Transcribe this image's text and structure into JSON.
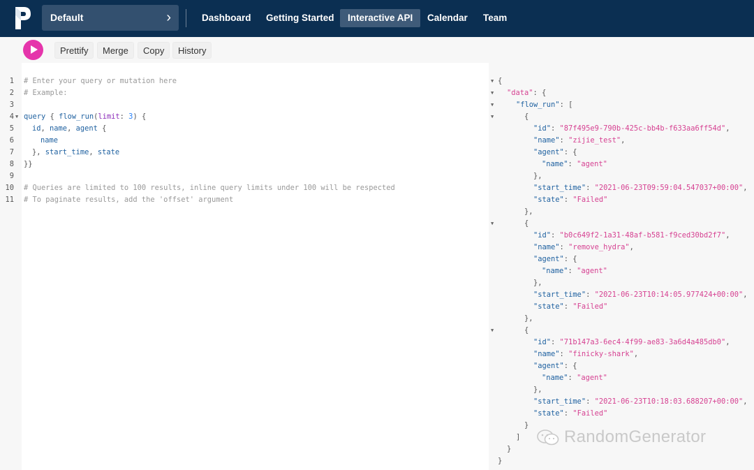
{
  "nav": {
    "project": "Default",
    "items": [
      "Dashboard",
      "Getting Started",
      "Interactive API",
      "Calendar",
      "Team"
    ],
    "active": "Interactive API"
  },
  "toolbar": {
    "prettify": "Prettify",
    "merge": "Merge",
    "copy": "Copy",
    "history": "History"
  },
  "editor": {
    "line_numbers": [
      "1",
      "2",
      "3",
      "4",
      "5",
      "6",
      "7",
      "8",
      "9",
      "10",
      "11"
    ],
    "lines": {
      "l1": "# Enter your query or mutation here",
      "l2": "# Example:",
      "l4_query": "query",
      "l4_open": " { ",
      "l4_field": "flow_run",
      "l4_paren": "(",
      "l4_arg": "limit",
      "l4_colon": ": ",
      "l4_num": "3",
      "l4_close": ") {",
      "l5_a": "id",
      "l5_c1": ", ",
      "l5_b": "name",
      "l5_c2": ", ",
      "l5_c": "agent",
      "l5_br": " {",
      "l6": "name",
      "l7_a": "}, ",
      "l7_b": "start_time",
      "l7_c": ", ",
      "l7_d": "state",
      "l8": "}}",
      "l10": "# Queries are limited to 100 results, inline query limits under 100 will be respected",
      "l11": "# To paginate results, add the 'offset' argument"
    }
  },
  "result": {
    "runs": [
      {
        "id": "\"87f495e9-790b-425c-bb4b-f633aa6ff54d\"",
        "name": "\"zijie_test\"",
        "agent_name": "\"agent\"",
        "start_time": "\"2021-06-23T09:59:04.547037+00:00\"",
        "state": "\"Failed\""
      },
      {
        "id": "\"b0c649f2-1a31-48af-b581-f9ced30bd2f7\"",
        "name": "\"remove_hydra\"",
        "agent_name": "\"agent\"",
        "start_time": "\"2021-06-23T10:14:05.977424+00:00\"",
        "state": "\"Failed\""
      },
      {
        "id": "\"71b147a3-6ec4-4f99-ae83-3a6d4a485db0\"",
        "name": "\"finicky-shark\"",
        "agent_name": "\"agent\"",
        "start_time": "\"2021-06-23T10:18:03.688207+00:00\"",
        "state": "\"Failed\""
      }
    ],
    "keys": {
      "data": "\"data\"",
      "flow_run": "\"flow_run\"",
      "id": "\"id\"",
      "name": "\"name\"",
      "agent": "\"agent\"",
      "start_time": "\"start_time\"",
      "state": "\"state\""
    }
  },
  "watermark": "RandomGenerator",
  "colors": {
    "nav_bg": "#0b2f52",
    "run_button": "#e535ab",
    "string": "#d64292",
    "key": "#1f61a0",
    "comment": "#999999"
  }
}
